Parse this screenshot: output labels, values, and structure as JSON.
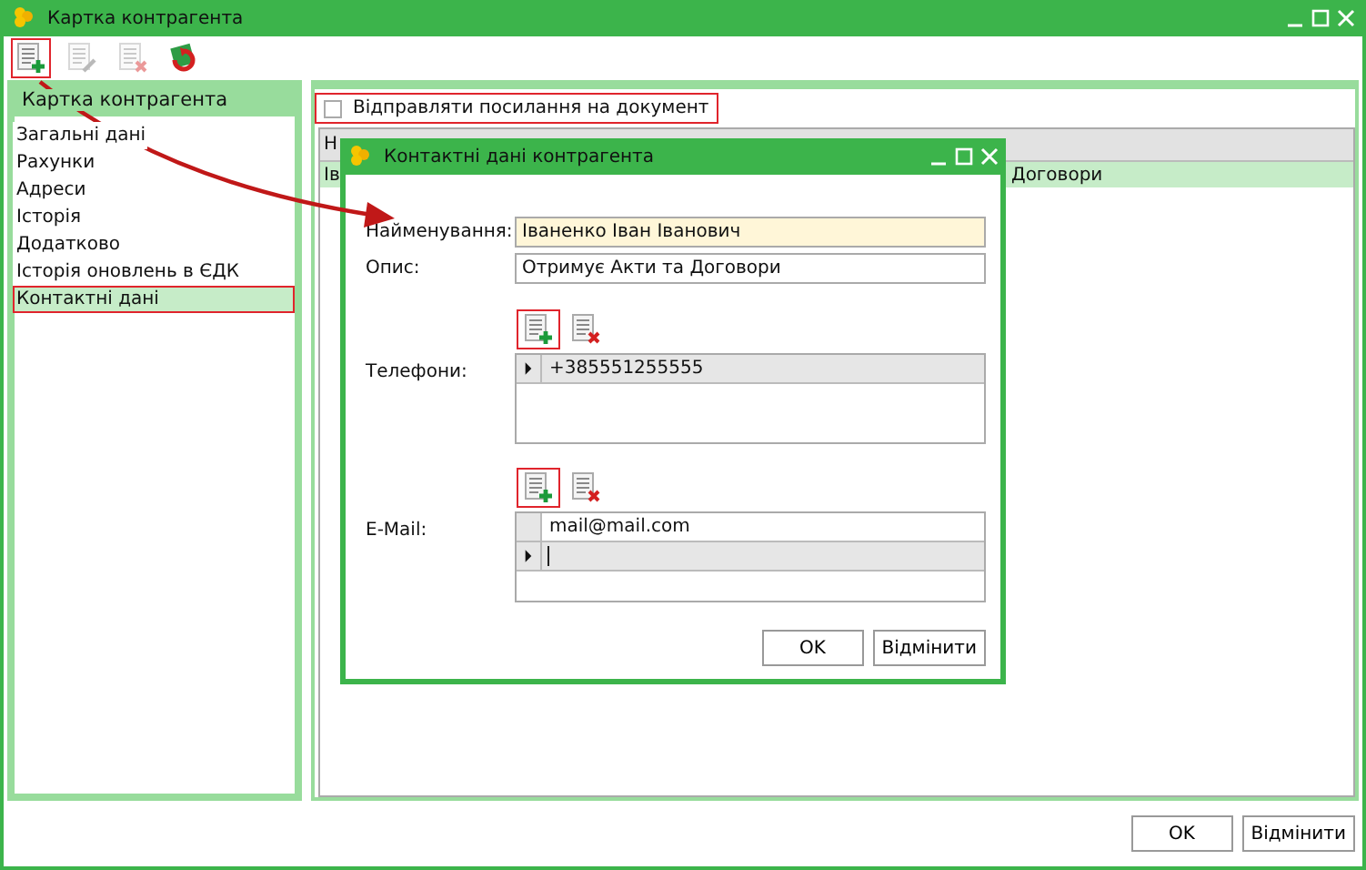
{
  "window": {
    "title": "Картка контрагента"
  },
  "toolbar": [
    {
      "kind": "add",
      "disabled": false,
      "highlighted": true
    },
    {
      "kind": "edit",
      "disabled": true,
      "highlighted": false
    },
    {
      "kind": "delete",
      "disabled": true,
      "highlighted": false
    },
    {
      "kind": "refresh",
      "disabled": false,
      "highlighted": false
    }
  ],
  "sidebar": {
    "title": "Картка контрагента",
    "items": [
      {
        "label": "Загальні дані",
        "selected": false,
        "highlighted": false
      },
      {
        "label": "Рахунки",
        "selected": false,
        "highlighted": false
      },
      {
        "label": "Адреси",
        "selected": false,
        "highlighted": false
      },
      {
        "label": "Історія",
        "selected": false,
        "highlighted": false
      },
      {
        "label": "Додатково",
        "selected": false,
        "highlighted": false
      },
      {
        "label": "Історія оновлень в ЄДК",
        "selected": false,
        "highlighted": false
      },
      {
        "label": "Контактні дані",
        "selected": true,
        "highlighted": true
      }
    ]
  },
  "send_link": {
    "label": "Відправляти посилання на документ",
    "checked": false,
    "highlighted": true
  },
  "table": {
    "columns": [
      "Н"
    ],
    "rows": [
      {
        "cells": [
          "Ів",
          "Договори"
        ],
        "selected": true
      }
    ]
  },
  "dialog": {
    "title": "Контактні дані контрагента",
    "fields": [
      {
        "label": "Найменування:",
        "value": "Іваненко Іван Іванович",
        "required": true
      },
      {
        "label": "Опис:",
        "value": "Отримує Акти та Договори",
        "required": false
      }
    ],
    "lists": [
      {
        "label": "Телефони:",
        "tools": [
          {
            "kind": "add",
            "highlighted": true
          },
          {
            "kind": "delete",
            "highlighted": false
          }
        ],
        "rows": [
          {
            "value": "+385551255555",
            "current": true
          }
        ]
      },
      {
        "label": "E-Mail:",
        "tools": [
          {
            "kind": "add",
            "highlighted": true
          },
          {
            "kind": "delete",
            "highlighted": false
          }
        ],
        "rows": [
          {
            "value": "mail@mail.com",
            "current": false
          },
          {
            "current": true,
            "editing": true
          }
        ]
      }
    ],
    "buttons": [
      "OK",
      "Відмінити"
    ]
  },
  "buttons": [
    "OK",
    "Відмінити"
  ]
}
